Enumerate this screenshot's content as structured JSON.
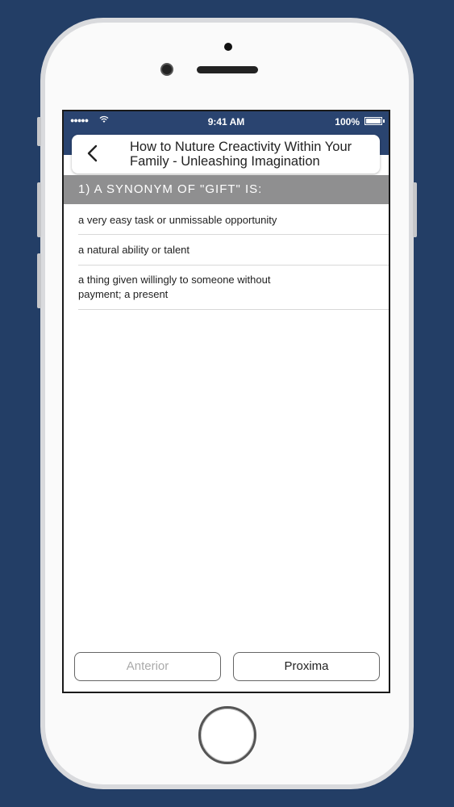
{
  "status_bar": {
    "signal": "●●●●●",
    "time": "9:41 AM",
    "battery": "100%"
  },
  "nav": {
    "back_icon": "chevron-left-icon",
    "title": "How to Nuture Creactivity Within Your Family - Unleashing Imagination"
  },
  "question": {
    "text": "1) A SYNONYM OF \"GIFT\" IS:"
  },
  "options": [
    "a very easy task or unmissable opportunity",
    "a natural ability or talent",
    "a thing given willingly to someone without payment; a present"
  ],
  "footer": {
    "prev_label": "Anterior",
    "next_label": "Proxima"
  },
  "colors": {
    "background": "#233e66",
    "status_bar": "#2a4470",
    "question_bar": "#8f8f90"
  }
}
